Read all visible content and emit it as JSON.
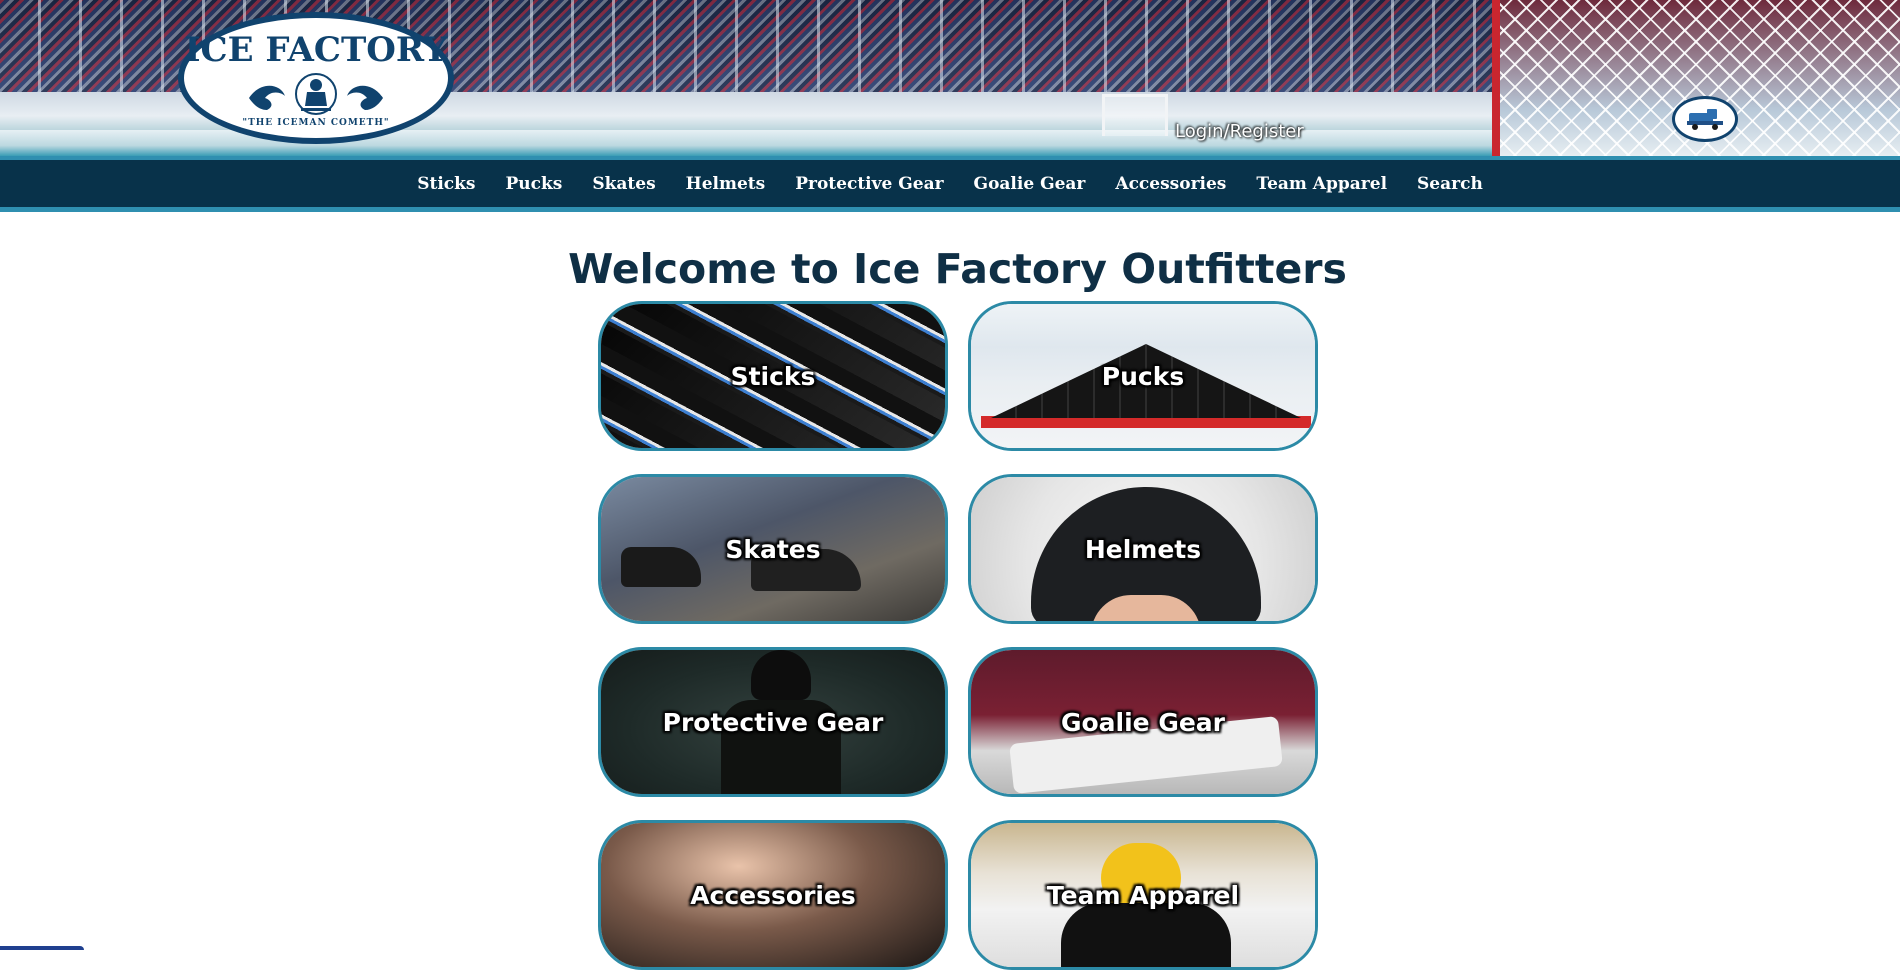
{
  "header": {
    "logo": {
      "title": "ICE FACTORY",
      "tagline": "\"THE ICEMAN COMETH\""
    },
    "login_label": "Login/Register",
    "zamboni_icon": "zamboni-icon"
  },
  "nav": {
    "items": [
      "Sticks",
      "Pucks",
      "Skates",
      "Helmets",
      "Protective Gear",
      "Goalie Gear",
      "Accessories",
      "Team Apparel",
      "Search"
    ]
  },
  "main": {
    "heading": "Welcome to Ice Factory Outfitters",
    "tiles": [
      "Sticks",
      "Pucks",
      "Skates",
      "Helmets",
      "Protective Gear",
      "Goalie Gear",
      "Accessories",
      "Team Apparel"
    ]
  },
  "colors": {
    "nav_bg": "#08324a",
    "accent": "#2f8fb0",
    "heading": "#0f2f45",
    "logo_blue": "#10436e"
  }
}
